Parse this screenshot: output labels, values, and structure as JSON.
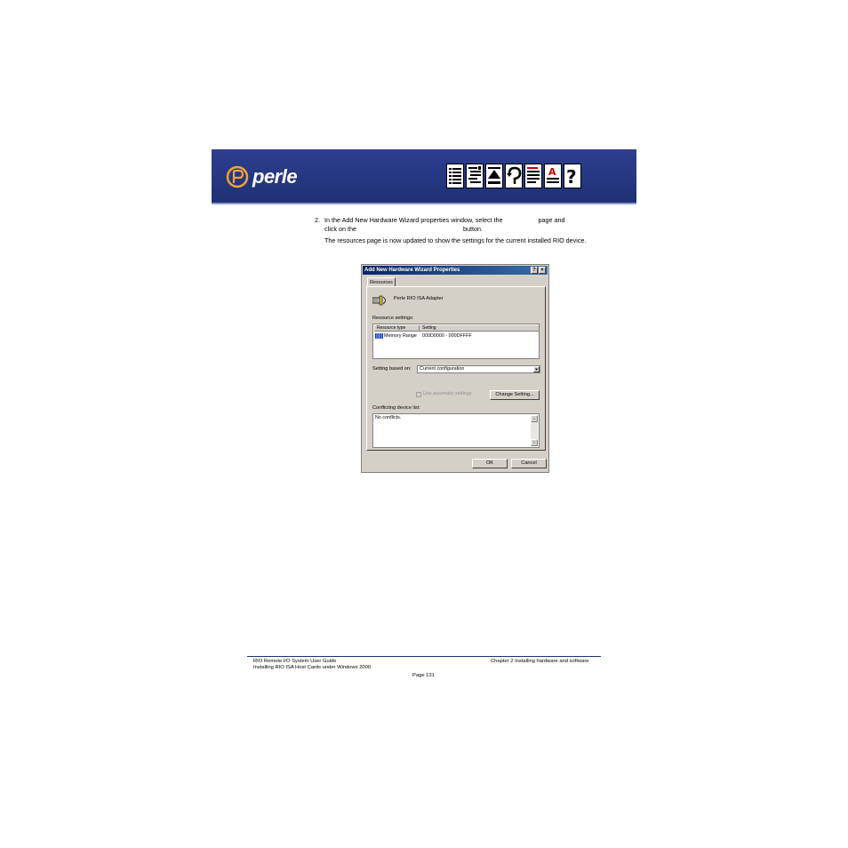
{
  "header": {
    "logo_text": "perle",
    "nav_icons": [
      "contents-icon",
      "index-icon",
      "top-icon",
      "back-icon",
      "previous-page-icon",
      "glossary-icon",
      "help-icon"
    ]
  },
  "body": {
    "step_number": "2.",
    "step_line1_a": "In the Add New Hardware Wizard properties window, select the",
    "step_line1_b": "page and",
    "step_line2_a": "click on the",
    "step_line2_b": "button.",
    "result_text": "The resources page is now updated to show the settings for the current installed RIO device."
  },
  "dialog": {
    "title": "Add New Hardware Wizard Properties",
    "help_btn": "?",
    "close_btn": "×",
    "tab": "Resources",
    "device_name": "Perle RIO ISA Adapter",
    "resource_settings_label": "Resource settings:",
    "columns": [
      "Resource type",
      "Setting"
    ],
    "row_type": "Memory Range",
    "row_setting": "000D0000 - 000DFFFF",
    "setting_based_on_label": "Setting based on:",
    "setting_based_on_value": "Current configuration",
    "auto_settings_label": "Use automatic settings",
    "change_setting_btn": "Change Setting...",
    "conflict_label": "Conflicting device list:",
    "conflict_value": "No conflicts.",
    "ok_btn": "OK",
    "cancel_btn": "Cancel"
  },
  "footer": {
    "left1": "RIO Remote I/O System User Guide",
    "left2": "Installing RIO ISA Host Cards under Windows 2000",
    "right1": "Chapter 2 Installing hardware and software",
    "page": "Page 131"
  },
  "colors": {
    "banner": "#24367f",
    "titlebar": "#0a246a",
    "dialog_face": "#d4d0c8"
  }
}
